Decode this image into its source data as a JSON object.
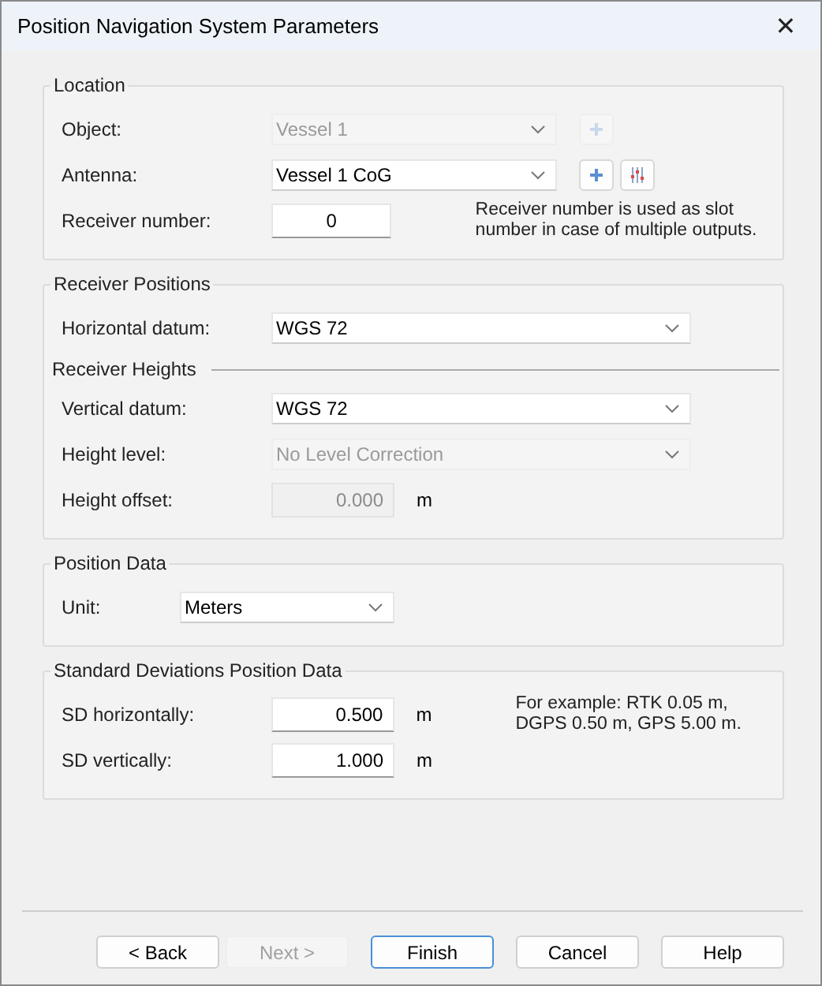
{
  "window": {
    "title": "Position Navigation System Parameters",
    "close": "✕"
  },
  "groups": [
    {
      "title": "Location",
      "rows": [
        {
          "kind": "combo",
          "label": "Object:",
          "value": "Vessel 1",
          "disabled": true,
          "buttons": [
            {
              "kind": "add",
              "disabled": true
            }
          ]
        },
        {
          "kind": "combo",
          "label": "Antenna:",
          "value": "Vessel 1 CoG",
          "disabled": false,
          "buttons": [
            {
              "kind": "add",
              "disabled": false
            },
            {
              "kind": "adjust",
              "disabled": false
            }
          ]
        },
        {
          "kind": "input",
          "label": "Receiver number:",
          "value": "0",
          "disabled": false,
          "note": "Receiver number is used as slot number in case of multiple outputs."
        }
      ]
    },
    {
      "title": "Receiver Positions",
      "rows": [
        {
          "kind": "combo",
          "label": "Horizontal datum:",
          "value": "WGS 72",
          "disabled": false
        },
        {
          "kind": "subheader",
          "label": "Receiver Heights"
        },
        {
          "kind": "combo",
          "label": "Vertical datum:",
          "value": "WGS 72",
          "disabled": false
        },
        {
          "kind": "combo",
          "label": "Height level:",
          "value": "No Level Correction",
          "disabled": true
        },
        {
          "kind": "input",
          "label": "Height offset:",
          "value": "0.000",
          "disabled": true,
          "unit": "m"
        }
      ]
    },
    {
      "title": "Position Data",
      "rows": [
        {
          "kind": "combo",
          "label": "Unit:",
          "value": "Meters",
          "disabled": false
        }
      ]
    },
    {
      "title": "Standard Deviations Position Data",
      "rows": [
        {
          "kind": "input",
          "label": "SD horizontally:",
          "value": "0.500",
          "disabled": false,
          "unit": "m",
          "note": "For example: RTK 0.05 m, DGPS 0.50 m, GPS 5.00 m."
        },
        {
          "kind": "input",
          "label": "SD vertically:",
          "value": "1.000",
          "disabled": false,
          "unit": "m"
        }
      ]
    }
  ],
  "buttons": [
    {
      "label": "< Back",
      "disabled": false,
      "default": false
    },
    {
      "label": "Next >",
      "disabled": true,
      "default": false
    },
    {
      "label": "Finish",
      "disabled": false,
      "default": true
    },
    {
      "label": "Cancel",
      "disabled": false,
      "default": false
    },
    {
      "label": "Help",
      "disabled": false,
      "default": false
    }
  ]
}
